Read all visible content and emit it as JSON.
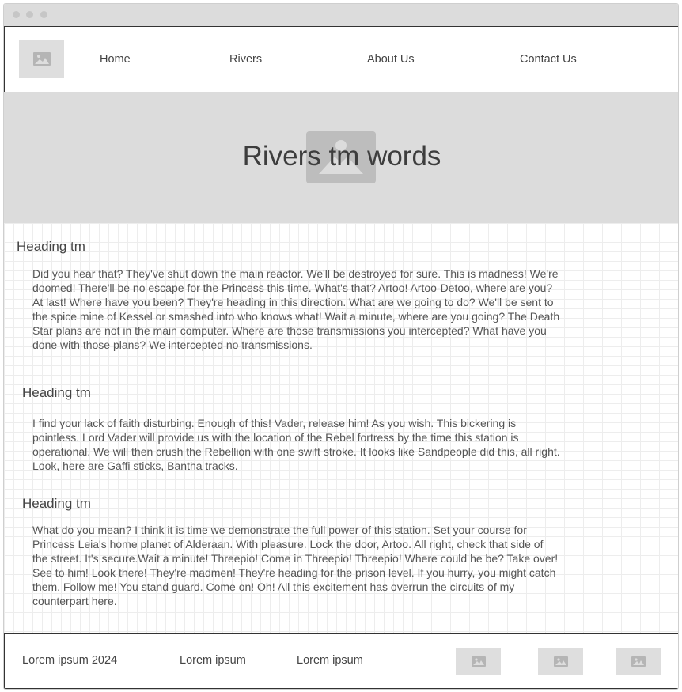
{
  "nav": {
    "logo_icon": "image-placeholder-icon",
    "links": [
      "Home",
      "Rivers",
      "About Us",
      "Contact Us"
    ]
  },
  "hero": {
    "title": "Rivers tm words",
    "image_icon": "image-placeholder-icon"
  },
  "sections": [
    {
      "heading": "Heading tm",
      "text": "Did you hear that? They've shut down the main reactor. We'll be destroyed for sure. This is madness! We're doomed! There'll be no escape for the Princess this time. What's that? Artoo! Artoo-Detoo, where are you? At last! Where have you been? They're heading in this direction. What are we going to do? We'll be sent to the spice mine of Kessel or smashed into who knows what! Wait a minute, where are you going? The Death Star plans are not in the main computer. Where are those transmissions you intercepted? What have you done with those plans? We intercepted no transmissions."
    },
    {
      "heading": "Heading tm",
      "text": "I find your lack of faith disturbing. Enough of this! Vader, release him! As you wish. This bickering is pointless. Lord Vader will provide us with the location of the Rebel fortress by the time this station is operational. We will then crush the Rebellion with one swift stroke. It looks like Sandpeople did this, all right. Look, here are Gaffi sticks, Bantha tracks."
    },
    {
      "heading": "Heading tm",
      "text": "What do you mean? I think it is time we demonstrate the full power of this station. Set your course for Princess Leia's home planet of Alderaan. With pleasure. Lock the door, Artoo. All right, check that side of the street. It's secure.Wait a minute! Threepio! Come in Threepio! Threepio! Where could he be? Take over! See to him! Look there! They're madmen! They're heading for the prison level. If you hurry, you might catch them. Follow me! You stand guard. Come on! Oh! All this excitement has overrun the circuits of my counterpart here."
    }
  ],
  "footer": {
    "texts": [
      "Lorem ipsum 2024",
      "Lorem ipsum",
      "Lorem ipsum"
    ],
    "image_icons": [
      "image-placeholder-icon",
      "image-placeholder-icon",
      "image-placeholder-icon"
    ]
  },
  "colors": {
    "placeholder_bg": "#dedede",
    "hero_bg": "#dcdcdc",
    "border": "#333333"
  }
}
